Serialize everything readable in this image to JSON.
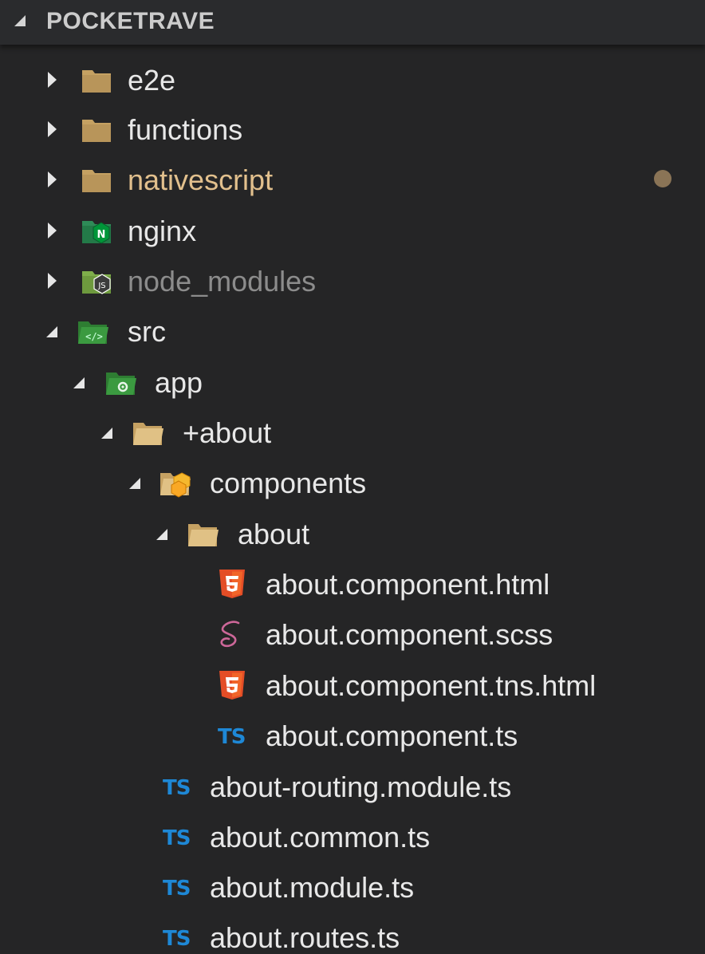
{
  "explorer": {
    "section_title": "POCKETRAVE",
    "items": [
      {
        "label": "e2e",
        "icon": "folder-icon"
      },
      {
        "label": "functions",
        "icon": "folder-icon"
      },
      {
        "label": "nativescript",
        "icon": "folder-icon",
        "status": "modified"
      },
      {
        "label": "nginx",
        "icon": "nginx-folder-icon"
      },
      {
        "label": "node_modules",
        "icon": "node-folder-icon",
        "status": "ignored"
      },
      {
        "label": "src",
        "icon": "src-folder-icon"
      },
      {
        "label": "app",
        "icon": "app-folder-icon"
      },
      {
        "label": "+about",
        "icon": "folder-open-icon"
      },
      {
        "label": "components",
        "icon": "components-folder-icon"
      },
      {
        "label": "about",
        "icon": "folder-open-icon"
      },
      {
        "label": "about.component.html",
        "icon": "html5-icon"
      },
      {
        "label": "about.component.scss",
        "icon": "sass-icon"
      },
      {
        "label": "about.component.tns.html",
        "icon": "html5-icon"
      },
      {
        "label": "about.component.ts",
        "icon": "typescript-icon",
        "icon_text": "TS"
      },
      {
        "label": "about-routing.module.ts",
        "icon": "typescript-icon",
        "icon_text": "TS"
      },
      {
        "label": "about.common.ts",
        "icon": "typescript-icon",
        "icon_text": "TS"
      },
      {
        "label": "about.module.ts",
        "icon": "typescript-icon",
        "icon_text": "TS"
      },
      {
        "label": "about.routes.ts",
        "icon": "typescript-icon",
        "icon_text": "TS"
      }
    ]
  },
  "colors": {
    "background": "#252526",
    "text": "#e8e8e8",
    "modified": "#e2c08d",
    "ignored": "#8c8c8c",
    "folder": "#c5a162",
    "typescript": "#1e88d6",
    "html5": "#e44d26",
    "sass": "#cd6799",
    "nginx": "#009639",
    "node": "#8cc84b"
  }
}
